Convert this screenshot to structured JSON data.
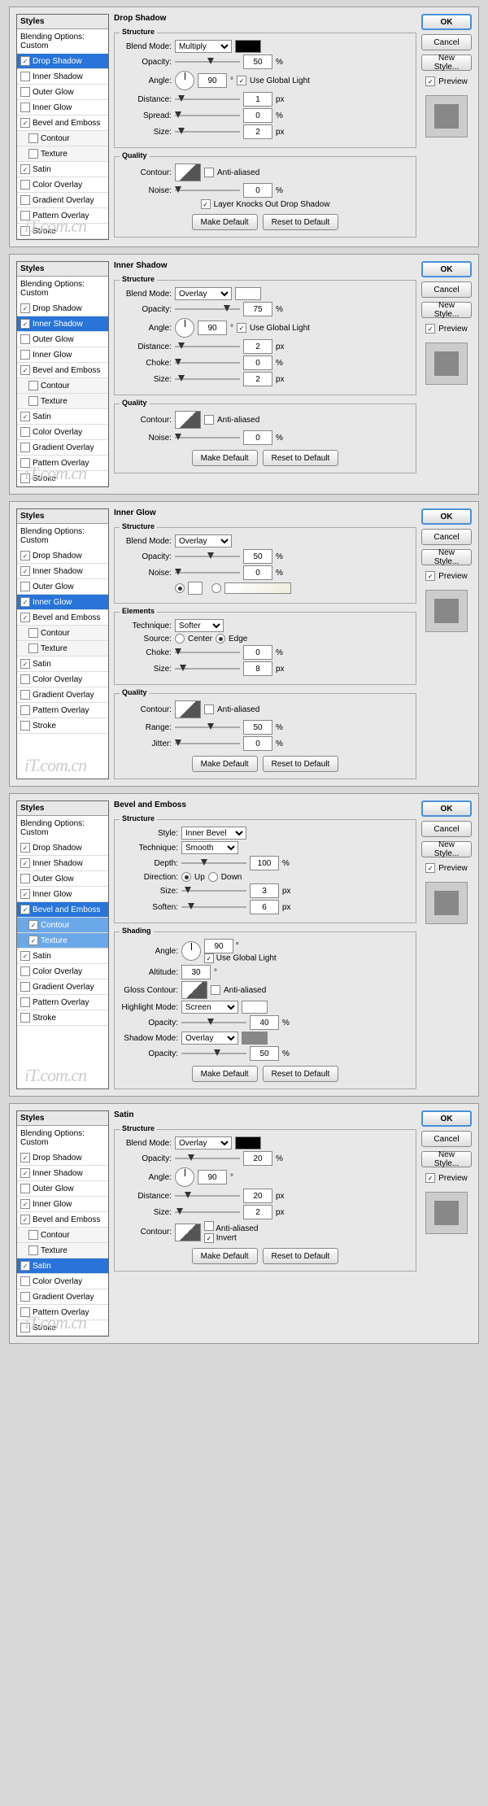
{
  "common": {
    "styles_title": "Styles",
    "blending_opts": "Blending Options: Custom",
    "structure": "Structure",
    "quality": "Quality",
    "elements": "Elements",
    "shading": "Shading",
    "blend_mode": "Blend Mode:",
    "opacity": "Opacity:",
    "angle": "Angle:",
    "distance": "Distance:",
    "spread": "Spread:",
    "choke": "Choke:",
    "size": "Size:",
    "noise": "Noise:",
    "contour": "Contour:",
    "anti_aliased": "Anti-aliased",
    "use_global": "Use Global Light",
    "make_default": "Make Default",
    "reset_default": "Reset to Default",
    "ok": "OK",
    "cancel": "Cancel",
    "new_style": "New Style...",
    "preview": "Preview",
    "pct": "%",
    "px": "px",
    "deg": "°",
    "technique": "Technique:",
    "source": "Source:",
    "center": "Center",
    "edge": "Edge",
    "range": "Range:",
    "jitter": "Jitter:",
    "style": "Style:",
    "depth": "Depth:",
    "direction": "Direction:",
    "up": "Up",
    "down": "Down",
    "soften": "Soften:",
    "altitude": "Altitude:",
    "gloss_contour": "Gloss Contour:",
    "highlight_mode": "Highlight Mode:",
    "shadow_mode": "Shadow Mode:",
    "invert": "Invert",
    "knocks_out": "Layer Knocks Out Drop Shadow"
  },
  "styles": [
    "Drop Shadow",
    "Inner Shadow",
    "Outer Glow",
    "Inner Glow",
    "Bevel and Emboss",
    "Contour",
    "Texture",
    "Satin",
    "Color Overlay",
    "Gradient Overlay",
    "Pattern Overlay",
    "Stroke"
  ],
  "panels": [
    {
      "title": "Drop Shadow",
      "sel": 0,
      "checks": [
        1,
        0,
        0,
        0,
        1,
        0,
        0,
        1,
        0,
        0,
        0,
        0
      ],
      "blend": "Multiply",
      "opacity": 50,
      "angle": 90,
      "distance": 1,
      "spread": 0,
      "size": 2,
      "noise": 0,
      "global": true,
      "knocks": true
    },
    {
      "title": "Inner Shadow",
      "sel": 1,
      "checks": [
        1,
        1,
        0,
        0,
        1,
        0,
        0,
        1,
        0,
        0,
        0,
        0
      ],
      "blend": "Overlay",
      "opacity": 75,
      "angle": 90,
      "distance": 2,
      "choke": 0,
      "size": 2,
      "noise": 0,
      "global": true
    },
    {
      "title": "Inner Glow",
      "sel": 3,
      "checks": [
        1,
        1,
        0,
        1,
        1,
        0,
        0,
        1,
        0,
        0,
        0,
        0
      ],
      "blend": "Overlay",
      "opacity": 50,
      "noise": 0,
      "technique": "Softer",
      "choke": 0,
      "size": 8,
      "range": 50,
      "jitter": 0
    },
    {
      "title": "Bevel and Emboss",
      "sel": 4,
      "checks": [
        1,
        1,
        0,
        1,
        1,
        1,
        1,
        1,
        0,
        0,
        0,
        0
      ],
      "style": "Inner Bevel",
      "technique": "Smooth",
      "depth": 100,
      "size": 3,
      "soften": 6,
      "angle": 90,
      "altitude": 30,
      "global": true,
      "hmode": "Screen",
      "hopacity": 40,
      "smode": "Overlay",
      "sopacity": 50
    },
    {
      "title": "Satin",
      "sel": 7,
      "checks": [
        1,
        1,
        0,
        1,
        1,
        0,
        0,
        1,
        0,
        0,
        0,
        0
      ],
      "blend": "Overlay",
      "opacity": 20,
      "angle": 90,
      "distance": 20,
      "size": 2,
      "invert": true
    }
  ],
  "watermark": "iT.com.cn"
}
